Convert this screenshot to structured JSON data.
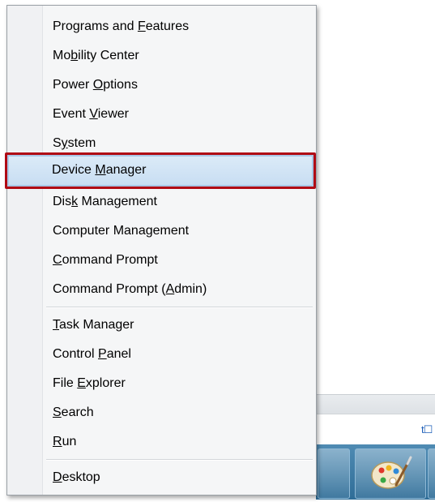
{
  "menu": {
    "groups": [
      [
        {
          "pre": "Programs and ",
          "key": "F",
          "post": "eatures"
        },
        {
          "pre": "Mo",
          "key": "b",
          "post": "ility Center"
        },
        {
          "pre": "Power ",
          "key": "O",
          "post": "ptions"
        },
        {
          "pre": "Event ",
          "key": "V",
          "post": "iewer"
        },
        {
          "pre": "S",
          "key": "y",
          "post": "stem"
        },
        {
          "pre": "Device ",
          "key": "M",
          "post": "anager"
        },
        {
          "pre": "Dis",
          "key": "k",
          "post": " Management"
        },
        {
          "pre": "Computer Mana",
          "key": "g",
          "post": "ement"
        },
        {
          "pre": "",
          "key": "C",
          "post": "ommand Prompt"
        },
        {
          "pre": "Command Prompt (",
          "key": "A",
          "post": "dmin)"
        }
      ],
      [
        {
          "pre": "",
          "key": "T",
          "post": "ask Manager"
        },
        {
          "pre": "Control ",
          "key": "P",
          "post": "anel"
        },
        {
          "pre": "File ",
          "key": "E",
          "post": "xplorer"
        },
        {
          "pre": "",
          "key": "S",
          "post": "earch"
        },
        {
          "pre": "",
          "key": "R",
          "post": "un"
        }
      ],
      [
        {
          "pre": "",
          "key": "D",
          "post": "esktop"
        }
      ]
    ],
    "highlighted": "Device Manager"
  },
  "background": {
    "address_fragment": "t☐"
  },
  "colors": {
    "highlight_border": "#b00a14",
    "highlight_fill": "#cfe2f5",
    "menu_bg": "#f5f6f7",
    "taskbar": "#3b78a3"
  }
}
